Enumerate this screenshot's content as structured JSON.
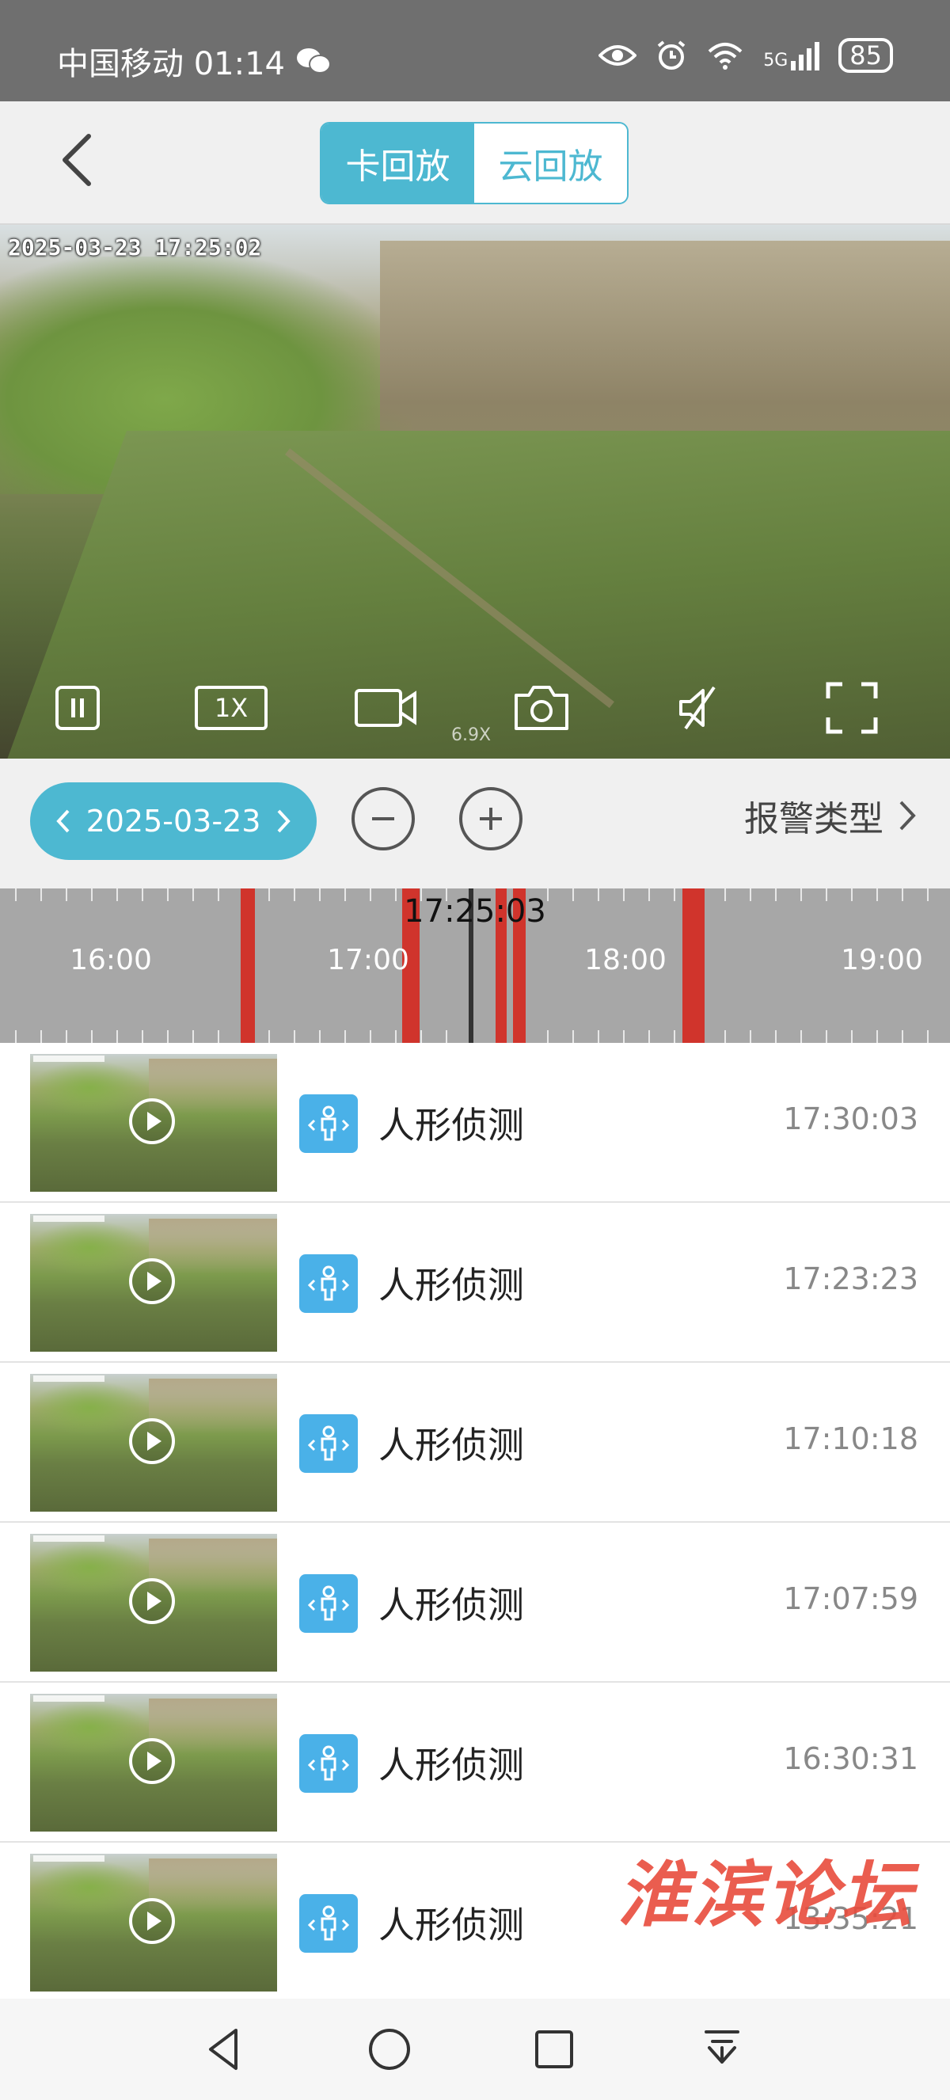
{
  "status_bar": {
    "carrier_time": "中国移动 01:14",
    "wechat_icon": "wechat-icon",
    "signal": "5G",
    "battery": "85"
  },
  "header": {
    "tabs": [
      {
        "label": "卡回放",
        "active": true
      },
      {
        "label": "云回放",
        "active": false
      }
    ]
  },
  "video": {
    "osd_timestamp": "2025-03-23 17:25:02",
    "zoom_level": "6.9X",
    "speed_label": "1X",
    "controls": [
      "pause-icon",
      "speed-button",
      "record-icon",
      "snapshot-icon",
      "mute-icon",
      "fullscreen-icon"
    ]
  },
  "toolbar": {
    "date": "2025-03-23",
    "alarm_type_label": "报警类型"
  },
  "timeline": {
    "current_time": "17:25:03",
    "labels": [
      "16:00",
      "17:00",
      "18:00",
      "19:00"
    ],
    "accent": "#d0342c"
  },
  "events": [
    {
      "type": "人形侦测",
      "time": "17:30:03"
    },
    {
      "type": "人形侦测",
      "time": "17:23:23"
    },
    {
      "type": "人形侦测",
      "time": "17:10:18"
    },
    {
      "type": "人形侦测",
      "time": "17:07:59"
    },
    {
      "type": "人形侦测",
      "time": "16:30:31"
    },
    {
      "type": "人形侦测",
      "time": "13:35:21"
    }
  ],
  "watermark": "淮滨论坛",
  "colors": {
    "accent": "#4db8d1",
    "event_icon": "#4ab1e8",
    "marker": "#d0342c"
  }
}
